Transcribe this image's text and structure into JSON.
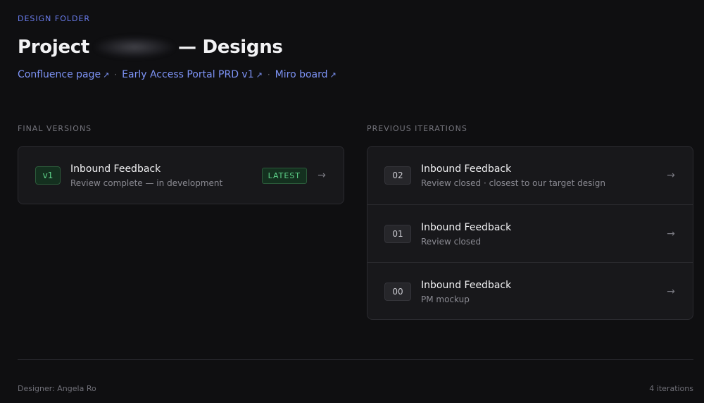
{
  "header": {
    "eyebrow": "DESIGN FOLDER",
    "title_prefix": "Project",
    "title_suffix": "— Designs",
    "links": [
      {
        "label": "Confluence page",
        "icon": "external-link-icon"
      },
      {
        "label": "Early Access Portal PRD v1",
        "icon": "external-link-icon"
      },
      {
        "label": "Miro board",
        "icon": "external-link-icon"
      }
    ],
    "separator": "·",
    "ext_glyph": "↗"
  },
  "final": {
    "label": "FINAL VERSIONS",
    "items": [
      {
        "badge": "v1",
        "title": "Inbound Feedback",
        "subtitle": "Review complete — in development",
        "tag": "LATEST",
        "arrow": "→"
      }
    ]
  },
  "previous": {
    "label": "PREVIOUS ITERATIONS",
    "items": [
      {
        "badge": "02",
        "title": "Inbound Feedback",
        "subtitle": "Review closed · closest to our target design",
        "arrow": "→"
      },
      {
        "badge": "01",
        "title": "Inbound Feedback",
        "subtitle": "Review closed",
        "arrow": "→"
      },
      {
        "badge": "00",
        "title": "Inbound Feedback",
        "subtitle": "PM mockup",
        "arrow": "→"
      }
    ]
  },
  "footer": {
    "designer": "Designer: Angela Ro",
    "count": "4 iterations"
  },
  "colors": {
    "background": "#0f0f11",
    "accent": "#7d93f5",
    "latest_green": "#5fd38a"
  }
}
